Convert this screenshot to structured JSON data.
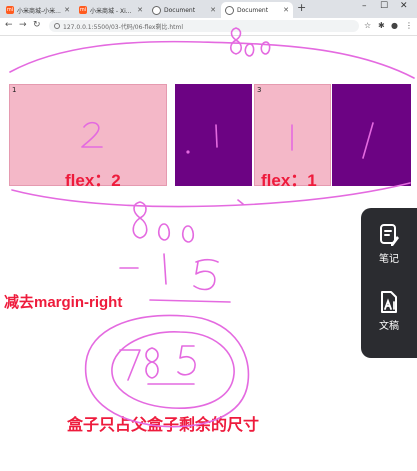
{
  "browser": {
    "tabs": [
      {
        "title": "小米商城-小米..."
      },
      {
        "title": "小米商城 - Xi..."
      },
      {
        "title": "Document"
      },
      {
        "title": "Document"
      }
    ],
    "url": "127.0.0.1:5500/03-代码/06-flex剩比.html"
  },
  "page": {
    "boxes": [
      {
        "number": "1",
        "color": "pink"
      },
      {
        "number": "",
        "color": "purple"
      },
      {
        "number": "3",
        "color": "pink"
      },
      {
        "number": "",
        "color": "purple"
      }
    ],
    "flex_label_1": "flex：2",
    "flex_label_2": "flex：1",
    "note_margin": "减去margin-right",
    "note_bottom": "盒子只占父盒子剩余的尺寸"
  },
  "side_panel": {
    "items": [
      {
        "label": "笔记",
        "icon": "note-pen-icon"
      },
      {
        "label": "文稿",
        "icon": "document-ai-icon"
      }
    ]
  },
  "handwriting": [
    "2",
    "1",
    "1",
    "1",
    "800",
    "785"
  ],
  "colors": {
    "ink": "#e46ae0",
    "label_red": "#ee1b3c",
    "pink": "#f4b8c8",
    "purple": "#6c0383"
  }
}
